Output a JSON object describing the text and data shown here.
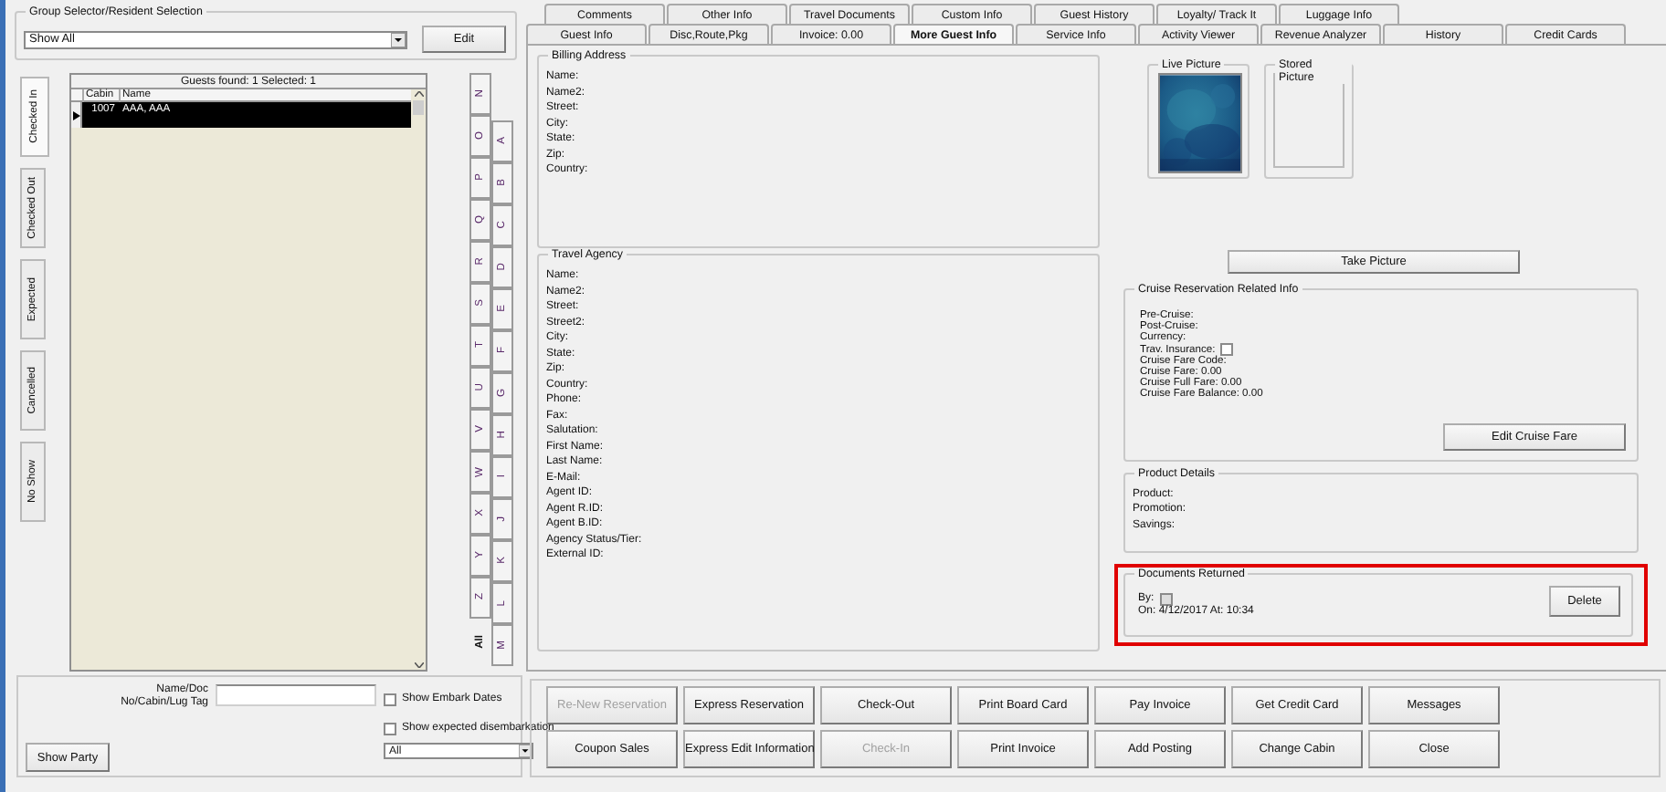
{
  "group_selector": {
    "title": "Group Selector/Resident Selection",
    "value": "Show All",
    "edit_button": "Edit"
  },
  "status_tabs": [
    {
      "label": "Checked In",
      "selected": true
    },
    {
      "label": "Checked Out",
      "selected": false
    },
    {
      "label": "Expected",
      "selected": false
    },
    {
      "label": "Cancelled",
      "selected": false
    },
    {
      "label": "No Show",
      "selected": false
    }
  ],
  "guest_list": {
    "summary": "Guests found: 1 Selected: 1",
    "columns": [
      "Cabin",
      "Name"
    ],
    "rows": [
      {
        "cabin": "1007",
        "name": "AAA, AAA",
        "selected": true
      }
    ]
  },
  "alpha_tabs_left": [
    "N",
    "O",
    "P",
    "Q",
    "R",
    "S",
    "T",
    "U",
    "V",
    "W",
    "X",
    "Y",
    "Z",
    "All"
  ],
  "alpha_tabs_right": [
    "A",
    "B",
    "C",
    "D",
    "E",
    "F",
    "G",
    "H",
    "I",
    "J",
    "K",
    "L",
    "M"
  ],
  "search": {
    "label": "Name/Doc No/Cabin/Lug Tag",
    "show_party_button": "Show Party",
    "options": [
      {
        "label": "Show Embark Dates",
        "checked": false
      },
      {
        "label": "Show expected disembarkation",
        "checked": false
      }
    ],
    "filter": "All"
  },
  "tabs_row_1": [
    {
      "label": "Comments",
      "selected": false
    },
    {
      "label": "Other Info",
      "selected": false
    },
    {
      "label": "Travel Documents",
      "selected": false
    },
    {
      "label": "Custom Info",
      "selected": false
    },
    {
      "label": "Guest History",
      "selected": false
    },
    {
      "label": "Loyalty/ Track It",
      "selected": false
    },
    {
      "label": "Luggage Info",
      "selected": false
    }
  ],
  "tabs_row_2": [
    {
      "label": "Guest Info",
      "selected": false
    },
    {
      "label": "Disc,Route,Pkg",
      "selected": false
    },
    {
      "label": "Invoice: 0.00",
      "selected": false
    },
    {
      "label": "More Guest Info",
      "selected": true
    },
    {
      "label": "Service Info",
      "selected": false
    },
    {
      "label": "Activity Viewer",
      "selected": false
    },
    {
      "label": "Revenue Analyzer",
      "selected": false
    },
    {
      "label": "History",
      "selected": false
    },
    {
      "label": "Credit Cards",
      "selected": false
    }
  ],
  "billing_address": {
    "title": "Billing Address",
    "fields": [
      "Name:",
      "Name2:",
      "Street:",
      "City:",
      "State:",
      "Zip:",
      "Country:"
    ]
  },
  "travel_agency": {
    "title": "Travel Agency",
    "fields": [
      "Name:",
      "Name2:",
      "Street:",
      "Street2:",
      "City:",
      "State:",
      "Zip:",
      "Country:",
      "Phone:",
      "Fax:",
      "Salutation:",
      "First Name:",
      "Last Name:",
      "E-Mail:",
      "Agent ID:",
      "Agent R.ID:",
      "Agent B.ID:",
      "Agency Status/Tier:",
      "External ID:"
    ]
  },
  "live_picture": {
    "title": "Live Picture",
    "kind": "picture"
  },
  "stored_picture": {
    "title": "Stored Picture"
  },
  "take_picture_button": "Take Picture",
  "cruise_info": {
    "title": "Cruise Reservation Related Info",
    "fields": [
      {
        "label": "Pre-Cruise:",
        "kind": "text"
      },
      {
        "label": "Post-Cruise:",
        "kind": "text"
      },
      {
        "label": "Currency:",
        "kind": "text"
      },
      {
        "label": "Trav. Insurance:",
        "kind": "checkbox",
        "checked": false
      },
      {
        "label": "Cruise Fare Code:",
        "kind": "text"
      },
      {
        "label": "Cruise Fare: 0.00",
        "kind": "text"
      },
      {
        "label": "Cruise Full Fare: 0.00",
        "kind": "text"
      },
      {
        "label": "Cruise Fare Balance: 0.00",
        "kind": "text"
      }
    ],
    "edit_button": "Edit Cruise Fare"
  },
  "product_details": {
    "title": "Product Details",
    "fields": [
      "Product:",
      "Promotion:",
      "Savings:"
    ]
  },
  "documents_returned": {
    "title": "Documents Returned",
    "by_label": "By:",
    "by_checked": false,
    "on_text": "On: 4/12/2017 At: 10:34",
    "delete_button": "Delete",
    "highlighted": true
  },
  "actions": [
    [
      {
        "label": "Re-New Reservation",
        "disabled": true
      },
      {
        "label": "Express Reservation",
        "disabled": false
      },
      {
        "label": "Check-Out",
        "disabled": false
      },
      {
        "label": "Print Board Card",
        "disabled": false
      },
      {
        "label": "Pay Invoice",
        "disabled": false
      },
      {
        "label": "Get Credit Card",
        "disabled": false
      },
      {
        "label": "Messages",
        "disabled": false
      }
    ],
    [
      {
        "label": "Coupon Sales",
        "disabled": false
      },
      {
        "label": "Express Edit Information",
        "disabled": false
      },
      {
        "label": "Check-In",
        "disabled": true
      },
      {
        "label": "Print Invoice",
        "disabled": false
      },
      {
        "label": "Add Posting",
        "disabled": false
      },
      {
        "label": "Change Cabin",
        "disabled": false
      },
      {
        "label": "Close",
        "disabled": false
      }
    ]
  ]
}
